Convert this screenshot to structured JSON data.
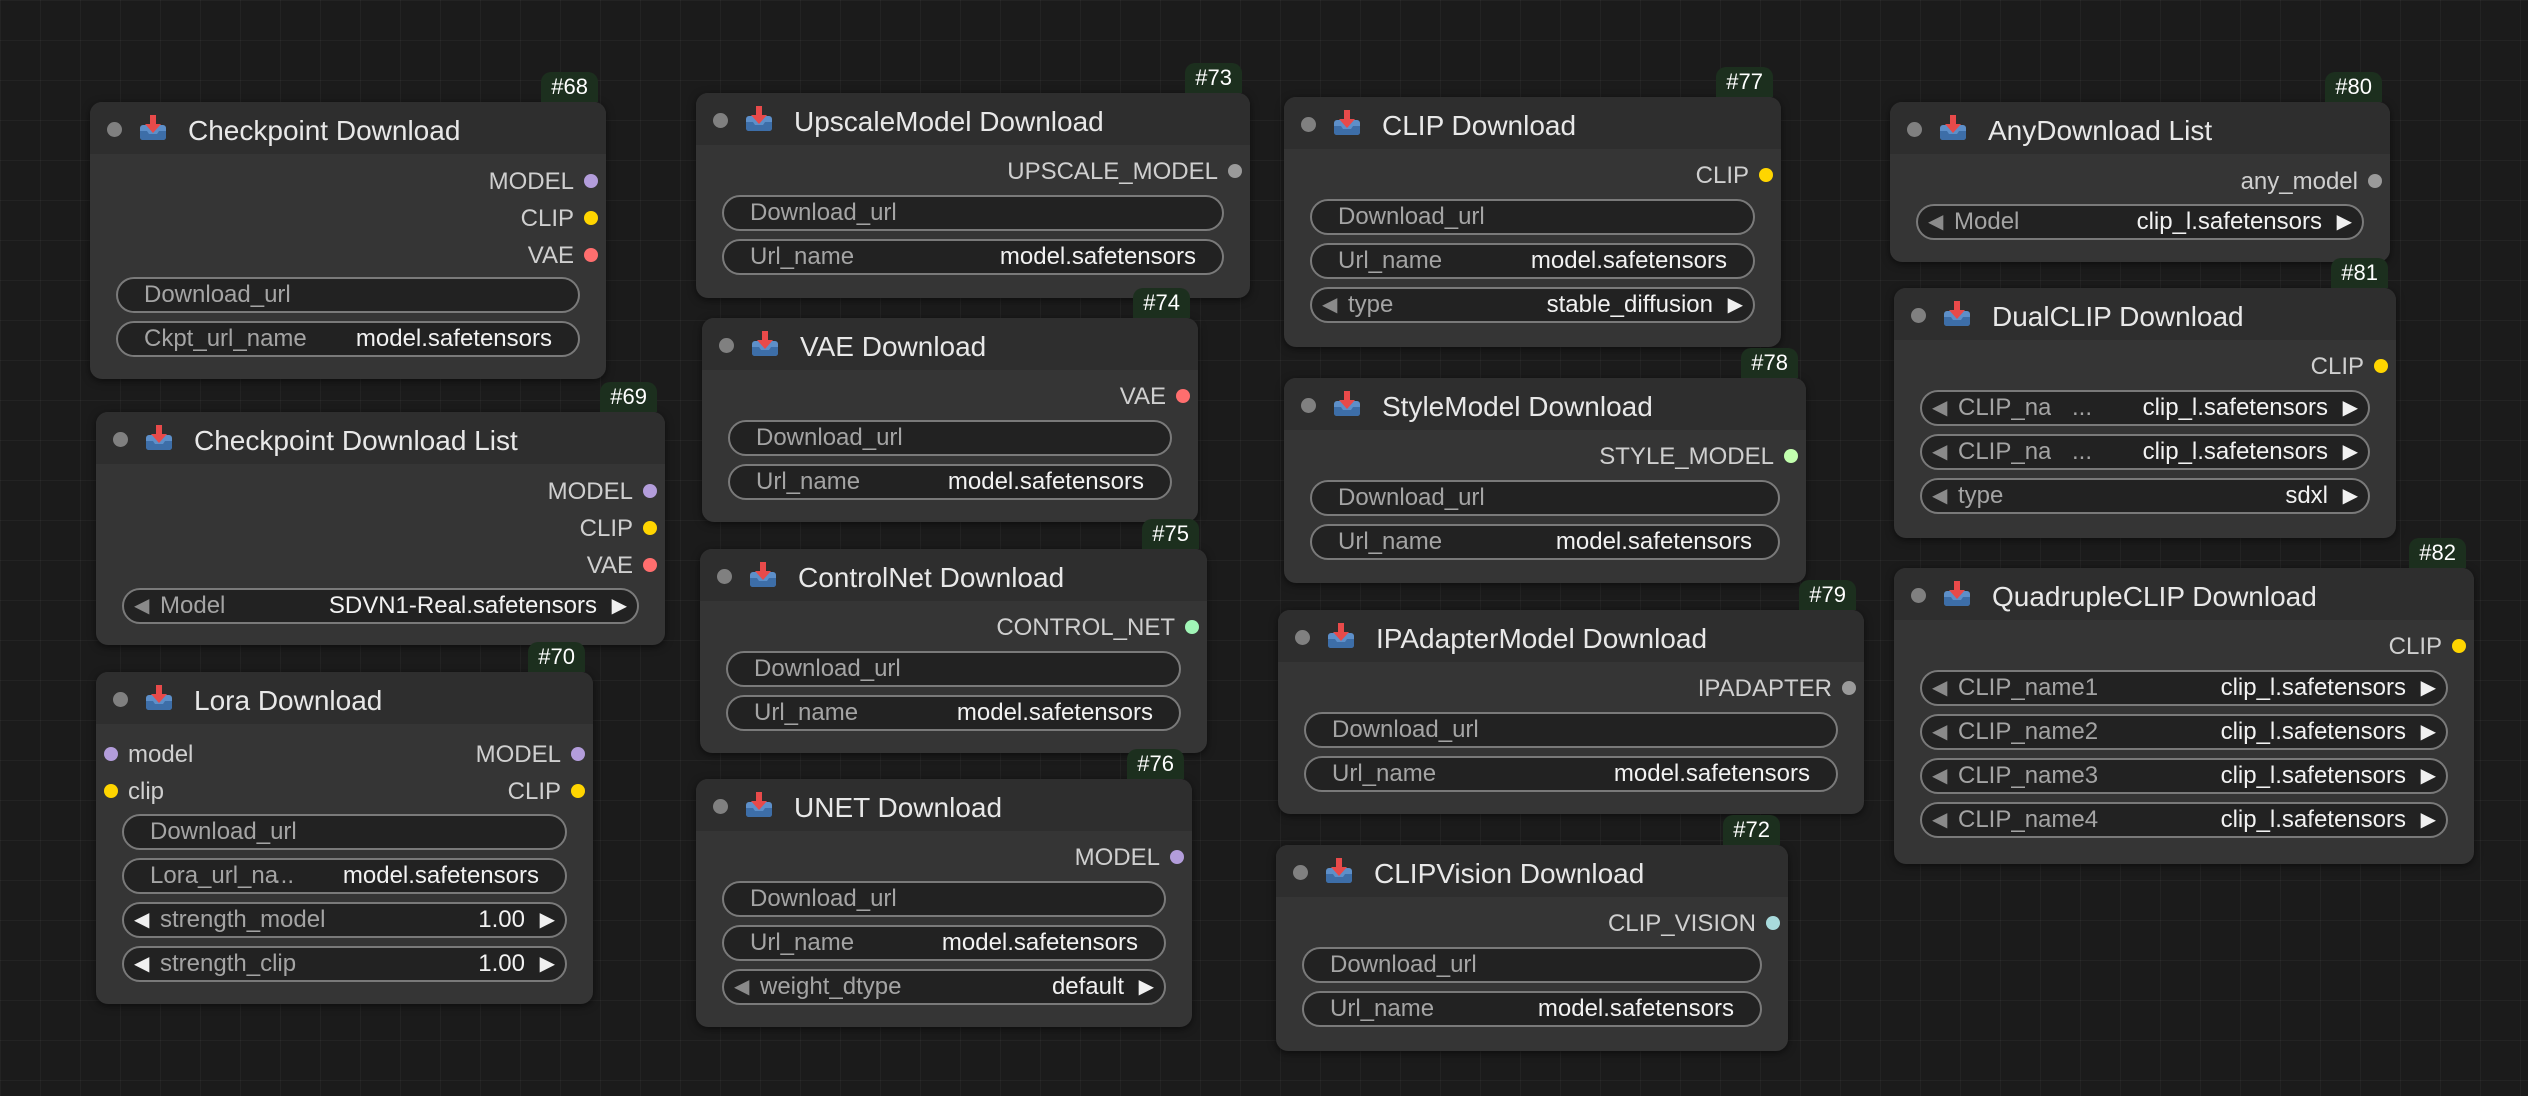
{
  "colors": {
    "canvas_bg": "#1b1b1b",
    "node_bg": "#353535",
    "node_header": "#2e2e2e",
    "badge_bg": "#1c2f1e",
    "MODEL": "#b39ddb",
    "CLIP": "#ffd500",
    "VAE": "#ff6e6e",
    "UPSCALE_MODEL": "#9a9a9a",
    "CONTROL_NET": "#a1f5b7",
    "STYLE_MODEL": "#c2ffae",
    "IPADAPTER": "#9a9a9a",
    "CLIP_VISION": "#a8dadc",
    "any": "#9a9a9a"
  },
  "icon": "download-inbox-icon",
  "nodes": {
    "n68": {
      "id": "#68",
      "title": "Checkpoint Download",
      "outputs": [
        "MODEL",
        "CLIP",
        "VAE"
      ],
      "widgets": [
        {
          "label": "Download_url",
          "value": ""
        },
        {
          "label": "Ckpt_url_name",
          "value": "model.safetensors"
        }
      ]
    },
    "n69": {
      "id": "#69",
      "title": "Checkpoint Download List",
      "outputs": [
        "MODEL",
        "CLIP",
        "VAE"
      ],
      "widgets": [
        {
          "label": "Model",
          "value": "SDVN1-Real.safetensors"
        }
      ]
    },
    "n70": {
      "id": "#70",
      "title": "Lora Download",
      "inputs": [
        "model",
        "clip"
      ],
      "outputs": [
        "MODEL",
        "CLIP"
      ],
      "widgets": [
        {
          "label": "Download_url",
          "value": ""
        },
        {
          "label": "Lora_url_na",
          "ellipsis": "...",
          "value": "model.safetensors"
        },
        {
          "label": "strength_model",
          "value": "1.00"
        },
        {
          "label": "strength_clip",
          "value": "1.00"
        }
      ]
    },
    "n73": {
      "id": "#73",
      "title": "UpscaleModel Download",
      "outputs": [
        "UPSCALE_MODEL"
      ],
      "widgets": [
        {
          "label": "Download_url",
          "value": ""
        },
        {
          "label": "Url_name",
          "value": "model.safetensors"
        }
      ]
    },
    "n74": {
      "id": "#74",
      "title": "VAE Download",
      "outputs": [
        "VAE"
      ],
      "widgets": [
        {
          "label": "Download_url",
          "value": ""
        },
        {
          "label": "Url_name",
          "value": "model.safetensors"
        }
      ]
    },
    "n75": {
      "id": "#75",
      "title": "ControlNet Download",
      "outputs": [
        "CONTROL_NET"
      ],
      "widgets": [
        {
          "label": "Download_url",
          "value": ""
        },
        {
          "label": "Url_name",
          "value": "model.safetensors"
        }
      ]
    },
    "n76": {
      "id": "#76",
      "title": "UNET Download",
      "outputs": [
        "MODEL"
      ],
      "widgets": [
        {
          "label": "Download_url",
          "value": ""
        },
        {
          "label": "Url_name",
          "value": "model.safetensors"
        },
        {
          "label": "weight_dtype",
          "value": "default"
        }
      ]
    },
    "n77": {
      "id": "#77",
      "title": "CLIP Download",
      "outputs": [
        "CLIP"
      ],
      "widgets": [
        {
          "label": "Download_url",
          "value": ""
        },
        {
          "label": "Url_name",
          "value": "model.safetensors"
        },
        {
          "label": "type",
          "value": "stable_diffusion"
        }
      ]
    },
    "n78": {
      "id": "#78",
      "title": "StyleModel Download",
      "outputs": [
        "STYLE_MODEL"
      ],
      "widgets": [
        {
          "label": "Download_url",
          "value": ""
        },
        {
          "label": "Url_name",
          "value": "model.safetensors"
        }
      ]
    },
    "n79": {
      "id": "#79",
      "title": "IPAdapterModel Download",
      "outputs": [
        "IPADAPTER"
      ],
      "widgets": [
        {
          "label": "Download_url",
          "value": ""
        },
        {
          "label": "Url_name",
          "value": "model.safetensors"
        }
      ]
    },
    "n72": {
      "id": "#72",
      "title": "CLIPVision Download",
      "outputs": [
        "CLIP_VISION"
      ],
      "widgets": [
        {
          "label": "Download_url",
          "value": ""
        },
        {
          "label": "Url_name",
          "value": "model.safetensors"
        }
      ]
    },
    "n80": {
      "id": "#80",
      "title": "AnyDownload List",
      "outputs": [
        "any_model"
      ],
      "widgets": [
        {
          "label": "Model",
          "value": "clip_l.safetensors"
        }
      ]
    },
    "n81": {
      "id": "#81",
      "title": "DualCLIP Download",
      "outputs": [
        "CLIP"
      ],
      "widgets": [
        {
          "label": "CLIP_na",
          "ellipsis": "...",
          "value": "clip_l.safetensors"
        },
        {
          "label": "CLIP_na",
          "ellipsis": "...",
          "value": "clip_l.safetensors"
        },
        {
          "label": "type",
          "value": "sdxl"
        }
      ]
    },
    "n82": {
      "id": "#82",
      "title": "QuadrupleCLIP Download",
      "outputs": [
        "CLIP"
      ],
      "widgets": [
        {
          "label": "CLIP_name1",
          "value": "clip_l.safetensors"
        },
        {
          "label": "CLIP_name2",
          "value": "clip_l.safetensors"
        },
        {
          "label": "CLIP_name3",
          "value": "clip_l.safetensors"
        },
        {
          "label": "CLIP_name4",
          "value": "clip_l.safetensors"
        }
      ]
    }
  }
}
